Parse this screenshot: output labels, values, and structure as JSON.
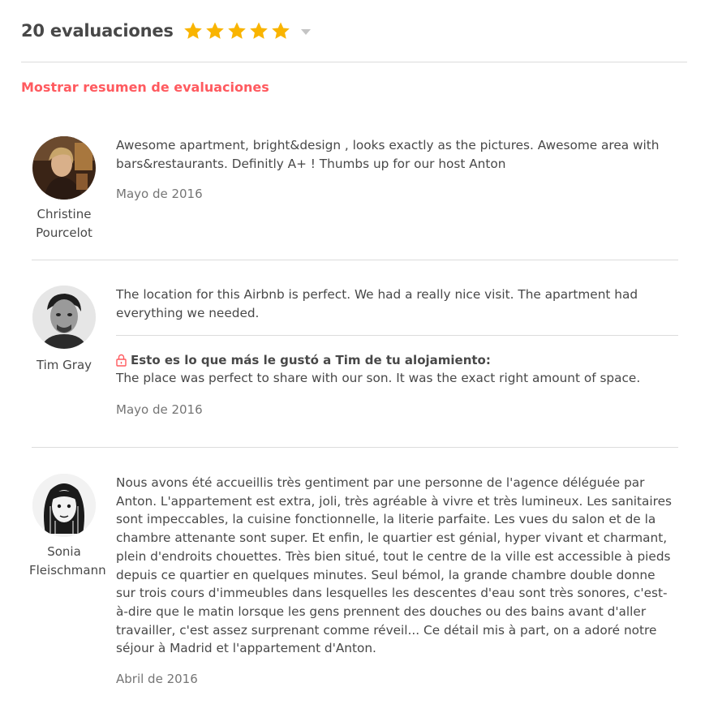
{
  "header": {
    "review_count": "20 evaluaciones",
    "rating_stars": 5,
    "star_color": "#f9b400",
    "caret_icon": "chevron-down-icon"
  },
  "summary_link": "Mostrar resumen de evaluaciones",
  "accent_color": "#ff5a5f",
  "reviews": [
    {
      "name_line1": "Christine",
      "name_line2": "Pourcelot",
      "text": "Awesome apartment, bright&design , looks exactly as the pictures. Awesome area with bars&restaurants. Definitly A+ ! Thumbs up for our host Anton",
      "date": "Mayo de 2016"
    },
    {
      "name_line1": "Tim Gray",
      "text": "The location for this Airbnb is perfect. We had a really nice visit. The apartment had everything we needed.",
      "liked_label": "Esto es lo que más le gustó a Tim de tu alojamiento:",
      "liked_text": "The place was perfect to share with our son. It was the exact right amount of space.",
      "date": "Mayo de 2016"
    },
    {
      "name_line1": "Sonia",
      "name_line2": "Fleischmann",
      "text": "Nous avons été accueillis très gentiment par une personne de l'agence déléguée par Anton. L'appartement est extra, joli, très agréable à vivre et très lumineux. Les sanitaires sont impeccables, la cuisine fonctionnelle, la literie parfaite. Les vues du salon et de la chambre attenante sont super. Et enfin, le quartier est génial, hyper vivant et charmant, plein d'endroits chouettes. Très bien situé, tout le centre de la ville est accessible à pieds depuis ce quartier en quelques minutes. Seul bémol, la grande chambre double donne sur trois cours d'immeubles dans lesquelles les descentes d'eau sont très sonores, c'est-à-dire que le matin lorsque les gens prennent des douches ou des bains avant d'aller travailler, c'est assez surprenant comme réveil... Ce détail mis à part, on a adoré notre séjour à Madrid et l'appartement d'Anton.",
      "date": "Abril de 2016"
    }
  ]
}
